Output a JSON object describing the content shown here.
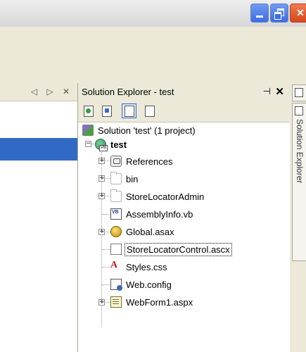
{
  "window": {
    "minimize_icon": "minimize-icon",
    "restore_icon": "restore-icon",
    "close_icon": "close-icon"
  },
  "document_pane": {
    "nav_glyphs": "◁ ▷ ✕"
  },
  "solution_explorer": {
    "title": "Solution Explorer - test",
    "pin_glyph": "⊣",
    "close_glyph": "✕",
    "toolbar": [
      "refresh-icon",
      "view-code-icon",
      "show-all-files-icon",
      "properties-icon"
    ],
    "items": [
      {
        "label": "Solution 'test' (1 project)",
        "icon": "solution-icon"
      },
      {
        "label": "test",
        "icon": "vb-project-icon",
        "bold": true
      },
      {
        "label": "References",
        "icon": "references-icon"
      },
      {
        "label": "bin",
        "icon": "folder-icon"
      },
      {
        "label": "StoreLocatorAdmin",
        "icon": "folder-icon"
      },
      {
        "label": "AssemblyInfo.vb",
        "icon": "vb-file-icon"
      },
      {
        "label": "Global.asax",
        "icon": "global-asax-icon"
      },
      {
        "label": "StoreLocatorControl.ascx",
        "icon": "ascx-file-icon",
        "focused": true
      },
      {
        "label": "Styles.css",
        "icon": "css-file-icon"
      },
      {
        "label": "Web.config",
        "icon": "config-file-icon"
      },
      {
        "label": "WebForm1.aspx",
        "icon": "aspx-file-icon"
      }
    ]
  },
  "side_strip": {
    "tab_label": "Solution Explorer"
  }
}
